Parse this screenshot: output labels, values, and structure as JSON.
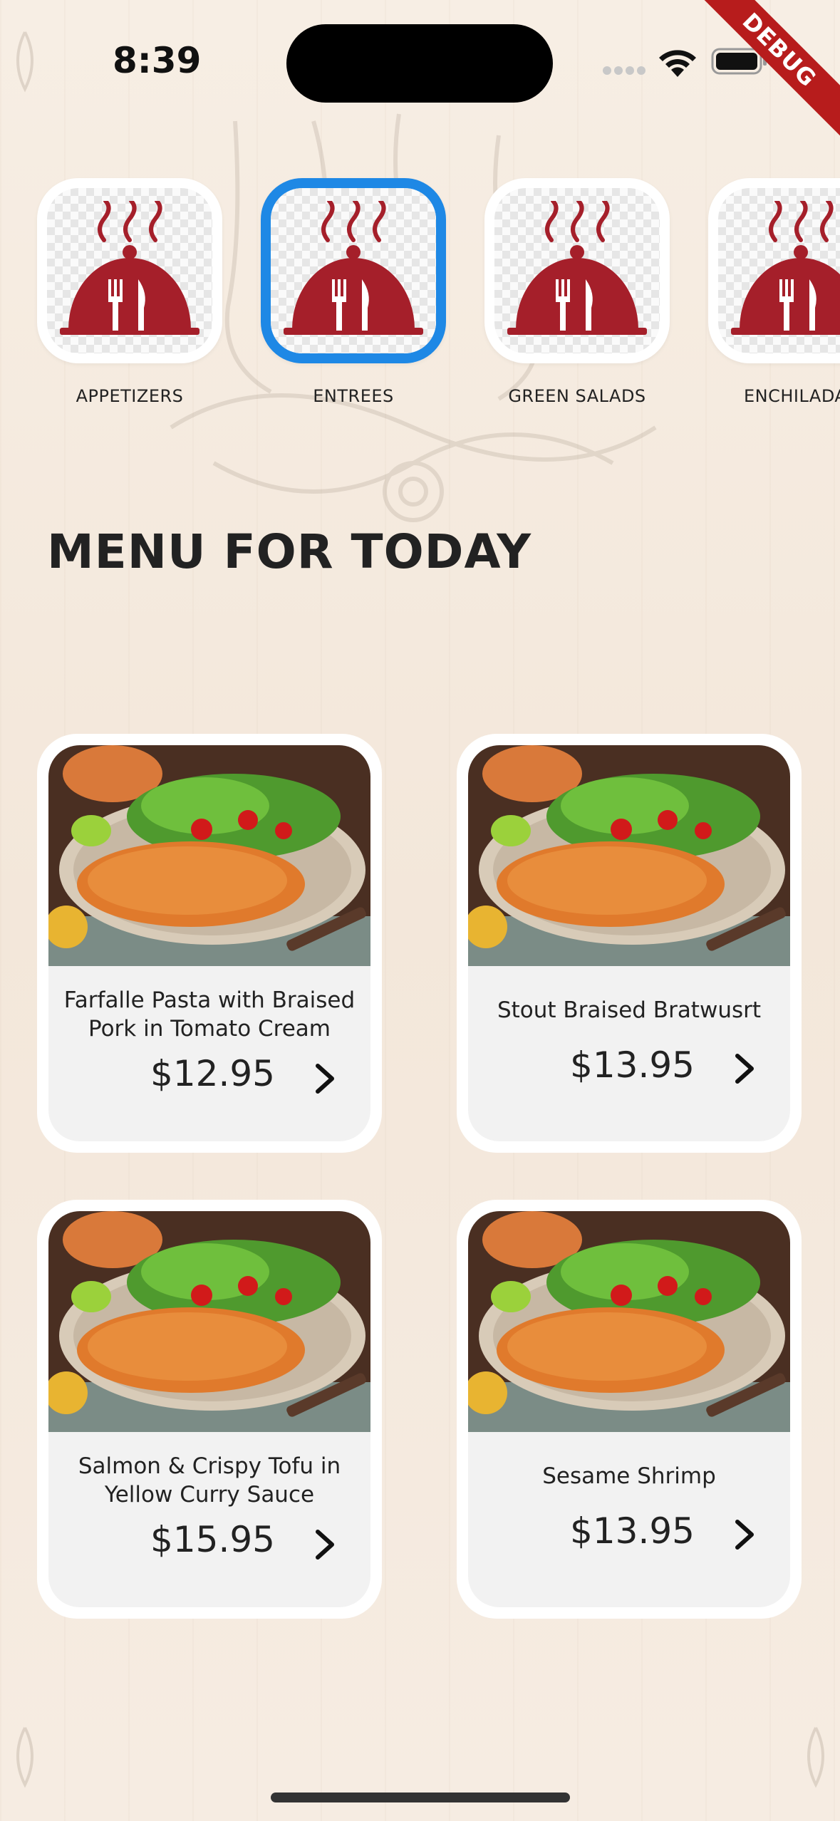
{
  "status_bar": {
    "time": "8:39",
    "debug_label": "DEBUG"
  },
  "categories": [
    {
      "label": "APPETIZERS",
      "selected": false,
      "icon": "cloche-icon"
    },
    {
      "label": "ENTREES",
      "selected": true,
      "icon": "cloche-icon"
    },
    {
      "label": "GREEN SALADS",
      "selected": false,
      "icon": "cloche-icon"
    },
    {
      "label": "ENCHILADA",
      "selected": false,
      "icon": "cloche-icon"
    }
  ],
  "menu": {
    "title": "MENU FOR TODAY",
    "items": [
      {
        "name": "Farfalle Pasta with Braised Pork in Tomato Cream",
        "price": "$12.95"
      },
      {
        "name": "Stout Braised Bratwusrt",
        "price": "$13.95"
      },
      {
        "name": "Salmon & Crispy Tofu in Yellow Curry Sauce",
        "price": "$15.95"
      },
      {
        "name": "Sesame Shrimp",
        "price": "$13.95"
      }
    ]
  },
  "colors": {
    "accent_selected": "#1e88e5",
    "icon_red": "#a51f2a",
    "debug_banner": "#b71c1c"
  }
}
